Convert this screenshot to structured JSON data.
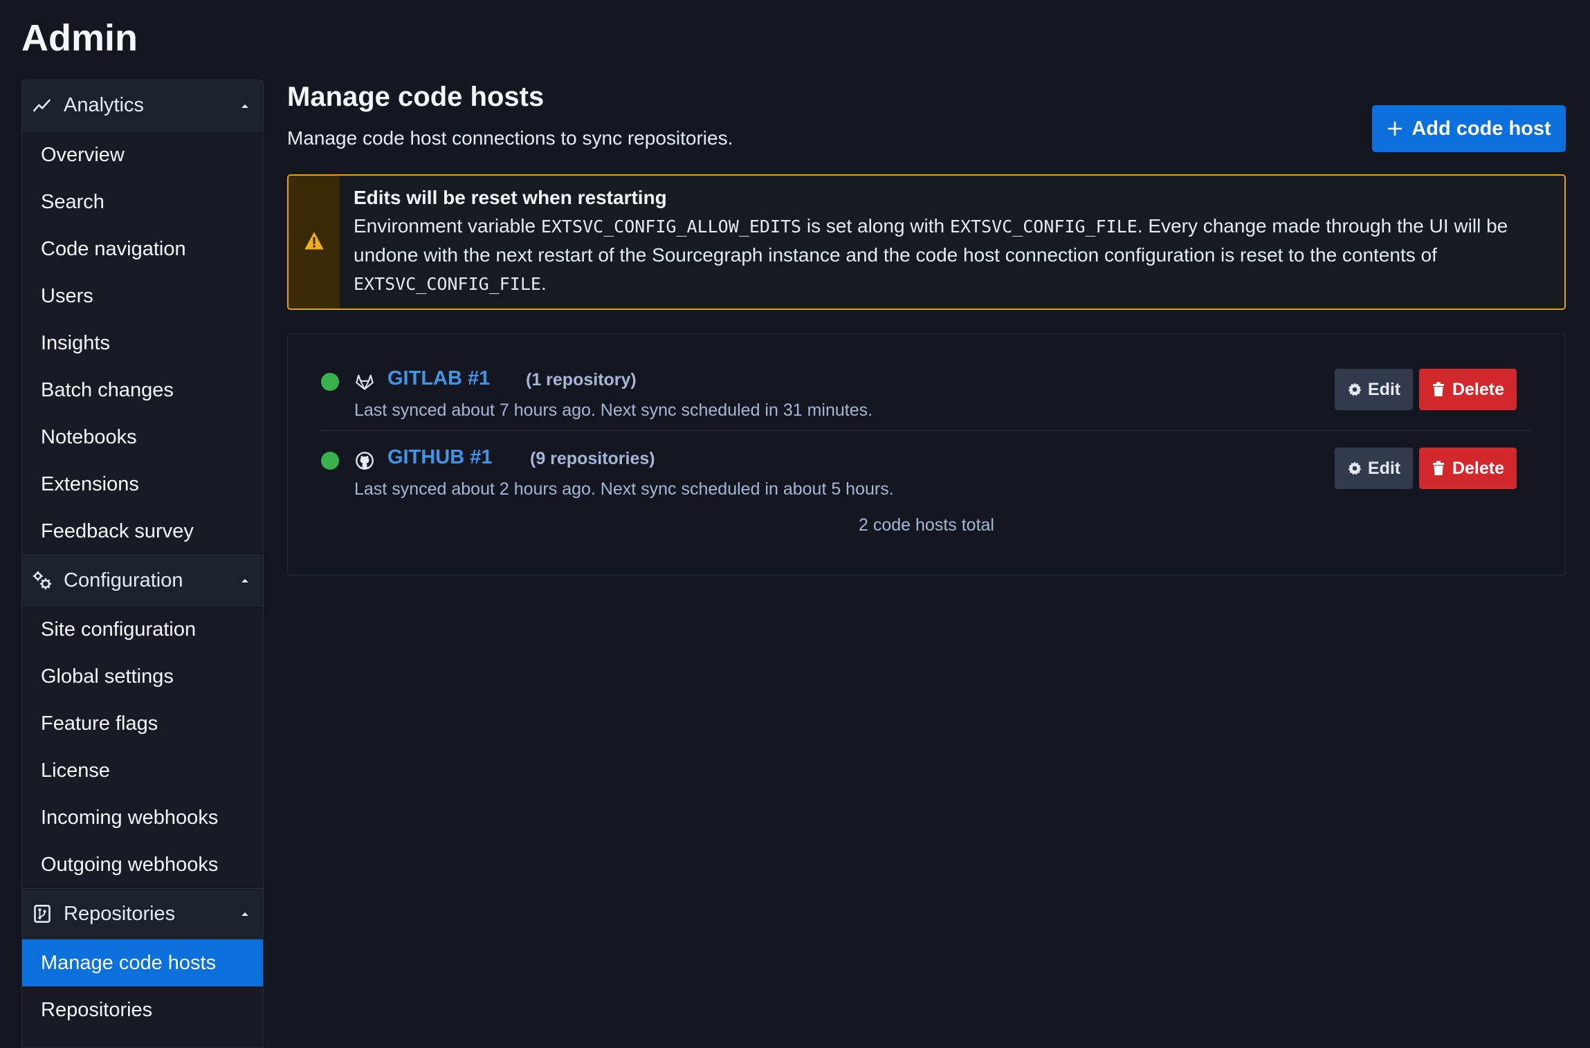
{
  "page": {
    "heading": "Admin"
  },
  "sidebar": {
    "sections": [
      {
        "label": "Analytics",
        "icon": "chart-line-icon",
        "items": [
          "Overview",
          "Search",
          "Code navigation",
          "Users",
          "Insights",
          "Batch changes",
          "Notebooks",
          "Extensions",
          "Feedback survey"
        ]
      },
      {
        "label": "Configuration",
        "icon": "cogs-icon",
        "items": [
          "Site configuration",
          "Global settings",
          "Feature flags",
          "License",
          "Incoming webhooks",
          "Outgoing webhooks"
        ]
      },
      {
        "label": "Repositories",
        "icon": "repository-icon",
        "items": [
          "Manage code hosts",
          "Repositories"
        ],
        "active_item": "Manage code hosts"
      }
    ]
  },
  "main": {
    "title": "Manage code hosts",
    "subtitle": "Manage code host connections to sync repositories.",
    "add_button_label": "Add code host",
    "alert": {
      "title": "Edits will be reset when restarting",
      "text_1": "Environment variable ",
      "code_1": "EXTSVC_CONFIG_ALLOW_EDITS",
      "text_2": " is set along with ",
      "code_2": "EXTSVC_CONFIG_FILE",
      "text_3": ". Every change made through the UI will be undone with the next restart of the Sourcegraph instance and the code host connection configuration is reset to the contents of ",
      "code_3": "EXTSVC_CONFIG_FILE",
      "text_4": "."
    },
    "hosts": [
      {
        "name": "GITLAB #1",
        "count": "(1 repository)",
        "status": "Last synced about 7 hours ago. Next sync scheduled in 31 minutes.",
        "icon": "gitlab-icon"
      },
      {
        "name": "GITHUB #1",
        "count": "(9 repositories)",
        "status": "Last synced about 2 hours ago. Next sync scheduled in about 5 hours.",
        "icon": "github-icon"
      }
    ],
    "edit_label": "Edit",
    "delete_label": "Delete",
    "total": "2 code hosts total"
  },
  "colors": {
    "background": "#14171f",
    "accent": "#0b70db",
    "link": "#4393e7",
    "warning": "#e3a007",
    "danger": "#d4292c",
    "success": "#37b24d"
  }
}
